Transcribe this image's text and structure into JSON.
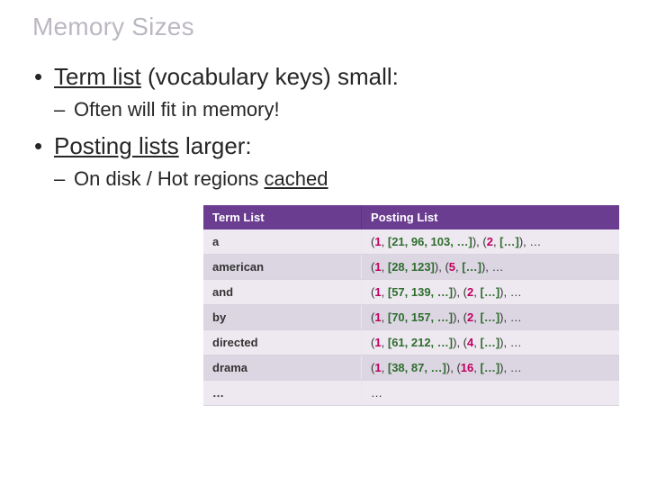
{
  "title": "Memory Sizes",
  "bullets": {
    "b1_pre": "Term list",
    "b1_post": " (vocabulary keys) small:",
    "b1_sub": "Often will fit in memory!",
    "b2_pre": "Posting lists",
    "b2_mid": " larger:",
    "b2_sub_pre": "On disk / Hot regions ",
    "b2_sub_u": "cached"
  },
  "table": {
    "headers": {
      "term": "Term List",
      "posting": "Posting List"
    },
    "rows": [
      {
        "term": "a",
        "posting": "(<span class='doc'>1</span>, <span class='pos'>[21, 96, 103, …]</span>), (<span class='doc'>2</span>, <span class='pos'>[…]</span>), …"
      },
      {
        "term": "american",
        "posting": "(<span class='doc'>1</span>, <span class='pos'>[28, 123]</span>), (<span class='doc'>5</span>, <span class='pos'>[…]</span>), …"
      },
      {
        "term": "and",
        "posting": "(<span class='doc'>1</span>, <span class='pos'>[57, 139, …]</span>), (<span class='doc'>2</span>, <span class='pos'>[…]</span>), …"
      },
      {
        "term": "by",
        "posting": "(<span class='doc'>1</span>, <span class='pos'>[70, 157, …]</span>), (<span class='doc'>2</span>, <span class='pos'>[…]</span>), …"
      },
      {
        "term": "directed",
        "posting": "(<span class='doc'>1</span>, <span class='pos'>[61, 212, …]</span>), (<span class='doc'>4</span>, <span class='pos'>[…]</span>), …"
      },
      {
        "term": "drama",
        "posting": "(<span class='doc'>1</span>, <span class='pos'>[38, 87, …]</span>), (<span class='doc'>16</span>, <span class='pos'>[…]</span>), …"
      },
      {
        "term": "…",
        "posting": "…"
      }
    ]
  }
}
